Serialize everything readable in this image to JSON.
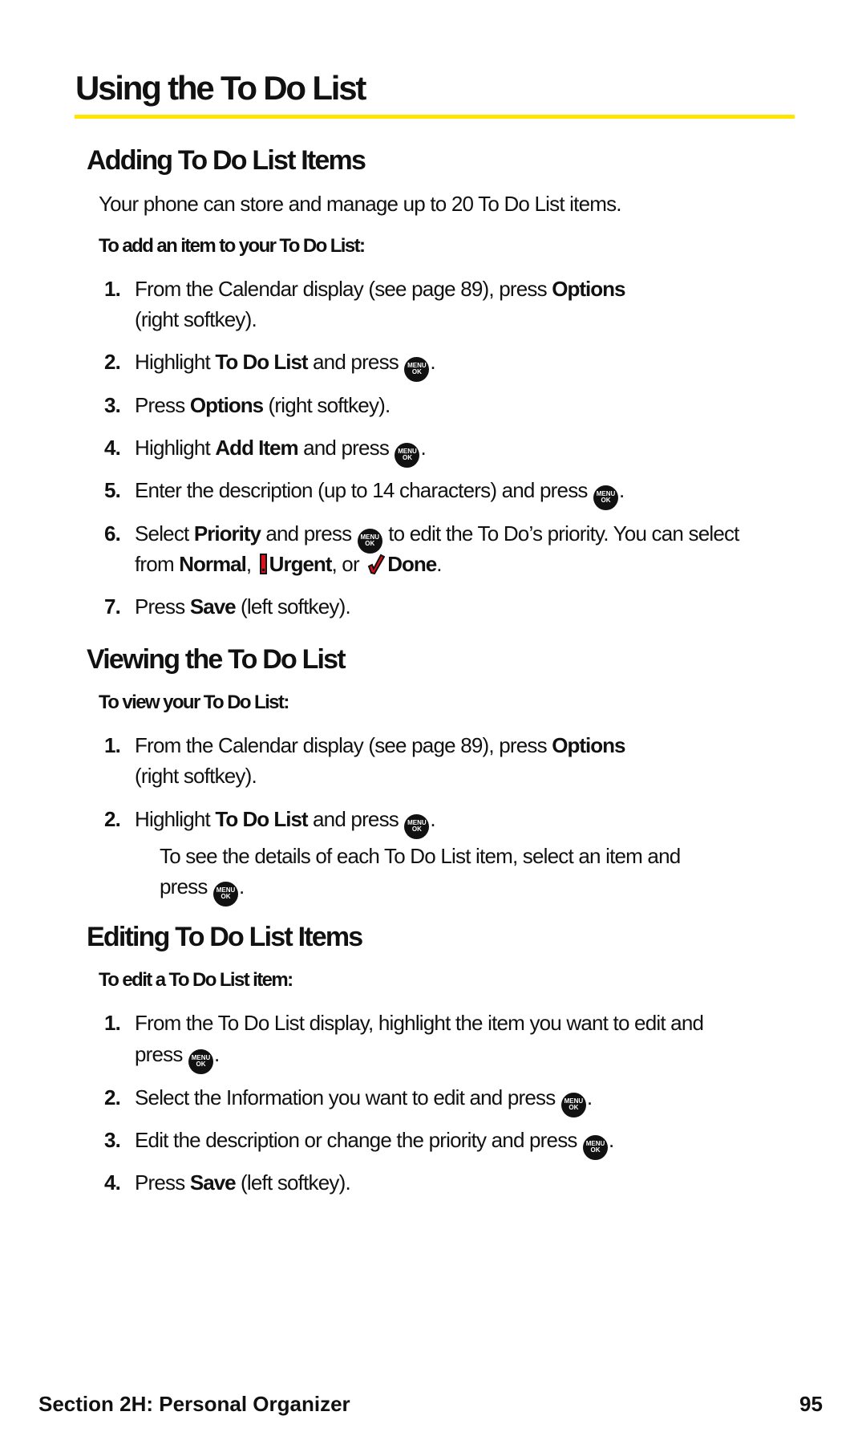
{
  "page": {
    "title": "Using the To Do List",
    "accent_color": "#ffe500"
  },
  "sections": [
    {
      "heading": "Adding To Do List Items",
      "intro": "Your phone can store and manage up to 20 To Do List items.",
      "subheading": "To add an item to your To Do List:",
      "steps": [
        {
          "num": "1.",
          "a": "From the Calendar display (see page 89), press ",
          "b": "Options",
          "c": "(right softkey)."
        },
        {
          "num": "2.",
          "a": "Highlight ",
          "b": "To Do List",
          "c": " and press",
          "d": "."
        },
        {
          "num": "3.",
          "a": "Press ",
          "b": "Options",
          "c": " (right softkey)."
        },
        {
          "num": "4.",
          "a": "Highlight ",
          "b": "Add Item",
          "c": " and press",
          "d": "."
        },
        {
          "num": "5.",
          "a": "Enter the description (up to 14 characters) and press",
          "d": "."
        },
        {
          "num": "6.",
          "a": "Select ",
          "b": "Priority",
          "c": " and press",
          "d": " to edit the To Do’s priority. You can select",
          "e": "from ",
          "f": "Normal",
          "g": ", ",
          "h": "Urgent",
          "i": ", or ",
          "j": "Done",
          "k": "."
        },
        {
          "num": "7.",
          "a": "Press ",
          "b": "Save",
          "c": " (left softkey)."
        }
      ]
    },
    {
      "heading": "Viewing the To Do List",
      "subheading": "To view your To Do List:",
      "steps": [
        {
          "num": "1.",
          "a": "From the Calendar display (see page 89), press ",
          "b": "Options",
          "c": "(right softkey)."
        },
        {
          "num": "2.",
          "a": "Highlight ",
          "b": "To Do List",
          "c": " and press",
          "d": "."
        }
      ],
      "note": {
        "a": "To see the details of each To Do List item, select an item and",
        "b": "press",
        "c": "."
      }
    },
    {
      "heading": "Editing To Do List Items",
      "subheading": "To edit a To Do List item:",
      "steps": [
        {
          "num": "1.",
          "a": "From the To Do List display, highlight the item you want to edit and",
          "b": "press",
          "c": "."
        },
        {
          "num": "2.",
          "a": "Select the Information you want to edit and press",
          "d": "."
        },
        {
          "num": "3.",
          "a": "Edit the description or change the priority and press",
          "d": "."
        },
        {
          "num": "4.",
          "a": "Press ",
          "b": "Save",
          "c": " (left softkey)."
        }
      ]
    }
  ],
  "key_icon": {
    "line1": "MENU",
    "line2": "OK"
  },
  "footer": {
    "section": "Section 2H: Personal Organizer",
    "page_number": "95"
  }
}
